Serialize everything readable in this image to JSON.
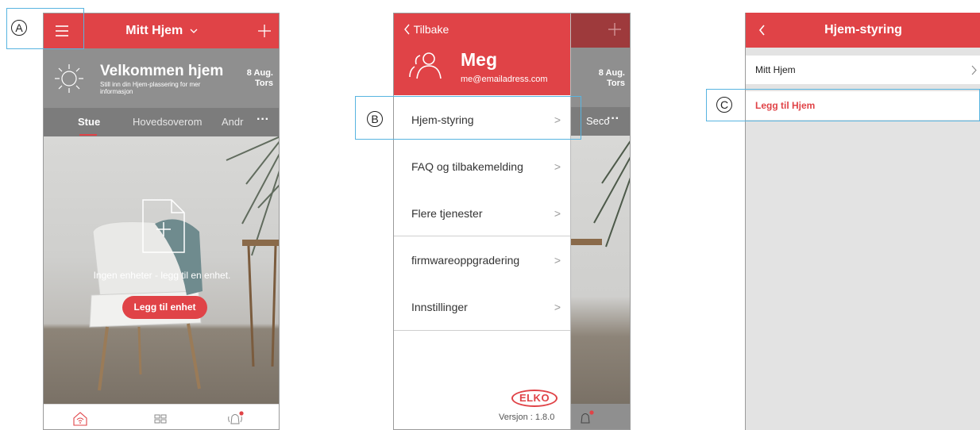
{
  "callouts": {
    "a": "A",
    "b": "B",
    "c": "C"
  },
  "screen1": {
    "title": "Mitt Hjem",
    "welcome_title": "Velkommen hjem",
    "welcome_subtitle": "Still inn din Hjem-plassering for mer informasjon",
    "date": "8 Aug.",
    "weekday": "Tors",
    "tabs": [
      "Stue",
      "Hovedsoverom",
      "Andr"
    ],
    "more": "···",
    "empty_text": "Ingen enheter - legg til en enhet.",
    "add_device_label": "Legg til enhet",
    "accent": "#e04347"
  },
  "screen2": {
    "back_label": "Tilbake",
    "user_name": "Meg",
    "user_email": "me@emailadress.com",
    "date": "8 Aug.",
    "weekday": "Tors",
    "tab_fragment": "Seco",
    "more": "···",
    "menu": [
      {
        "label": "Hjem-styring"
      },
      {
        "label": "FAQ og tilbakemelding"
      },
      {
        "label": "Flere tjenester"
      },
      {
        "label": "firmwareoppgradering"
      },
      {
        "label": "Innstillinger"
      }
    ],
    "brand": "ELKO",
    "version": "Versjon : 1.8.0"
  },
  "screen3": {
    "title": "Hjem-styring",
    "home_item": "Mitt Hjem",
    "add_home_label": "Legg til Hjem"
  }
}
